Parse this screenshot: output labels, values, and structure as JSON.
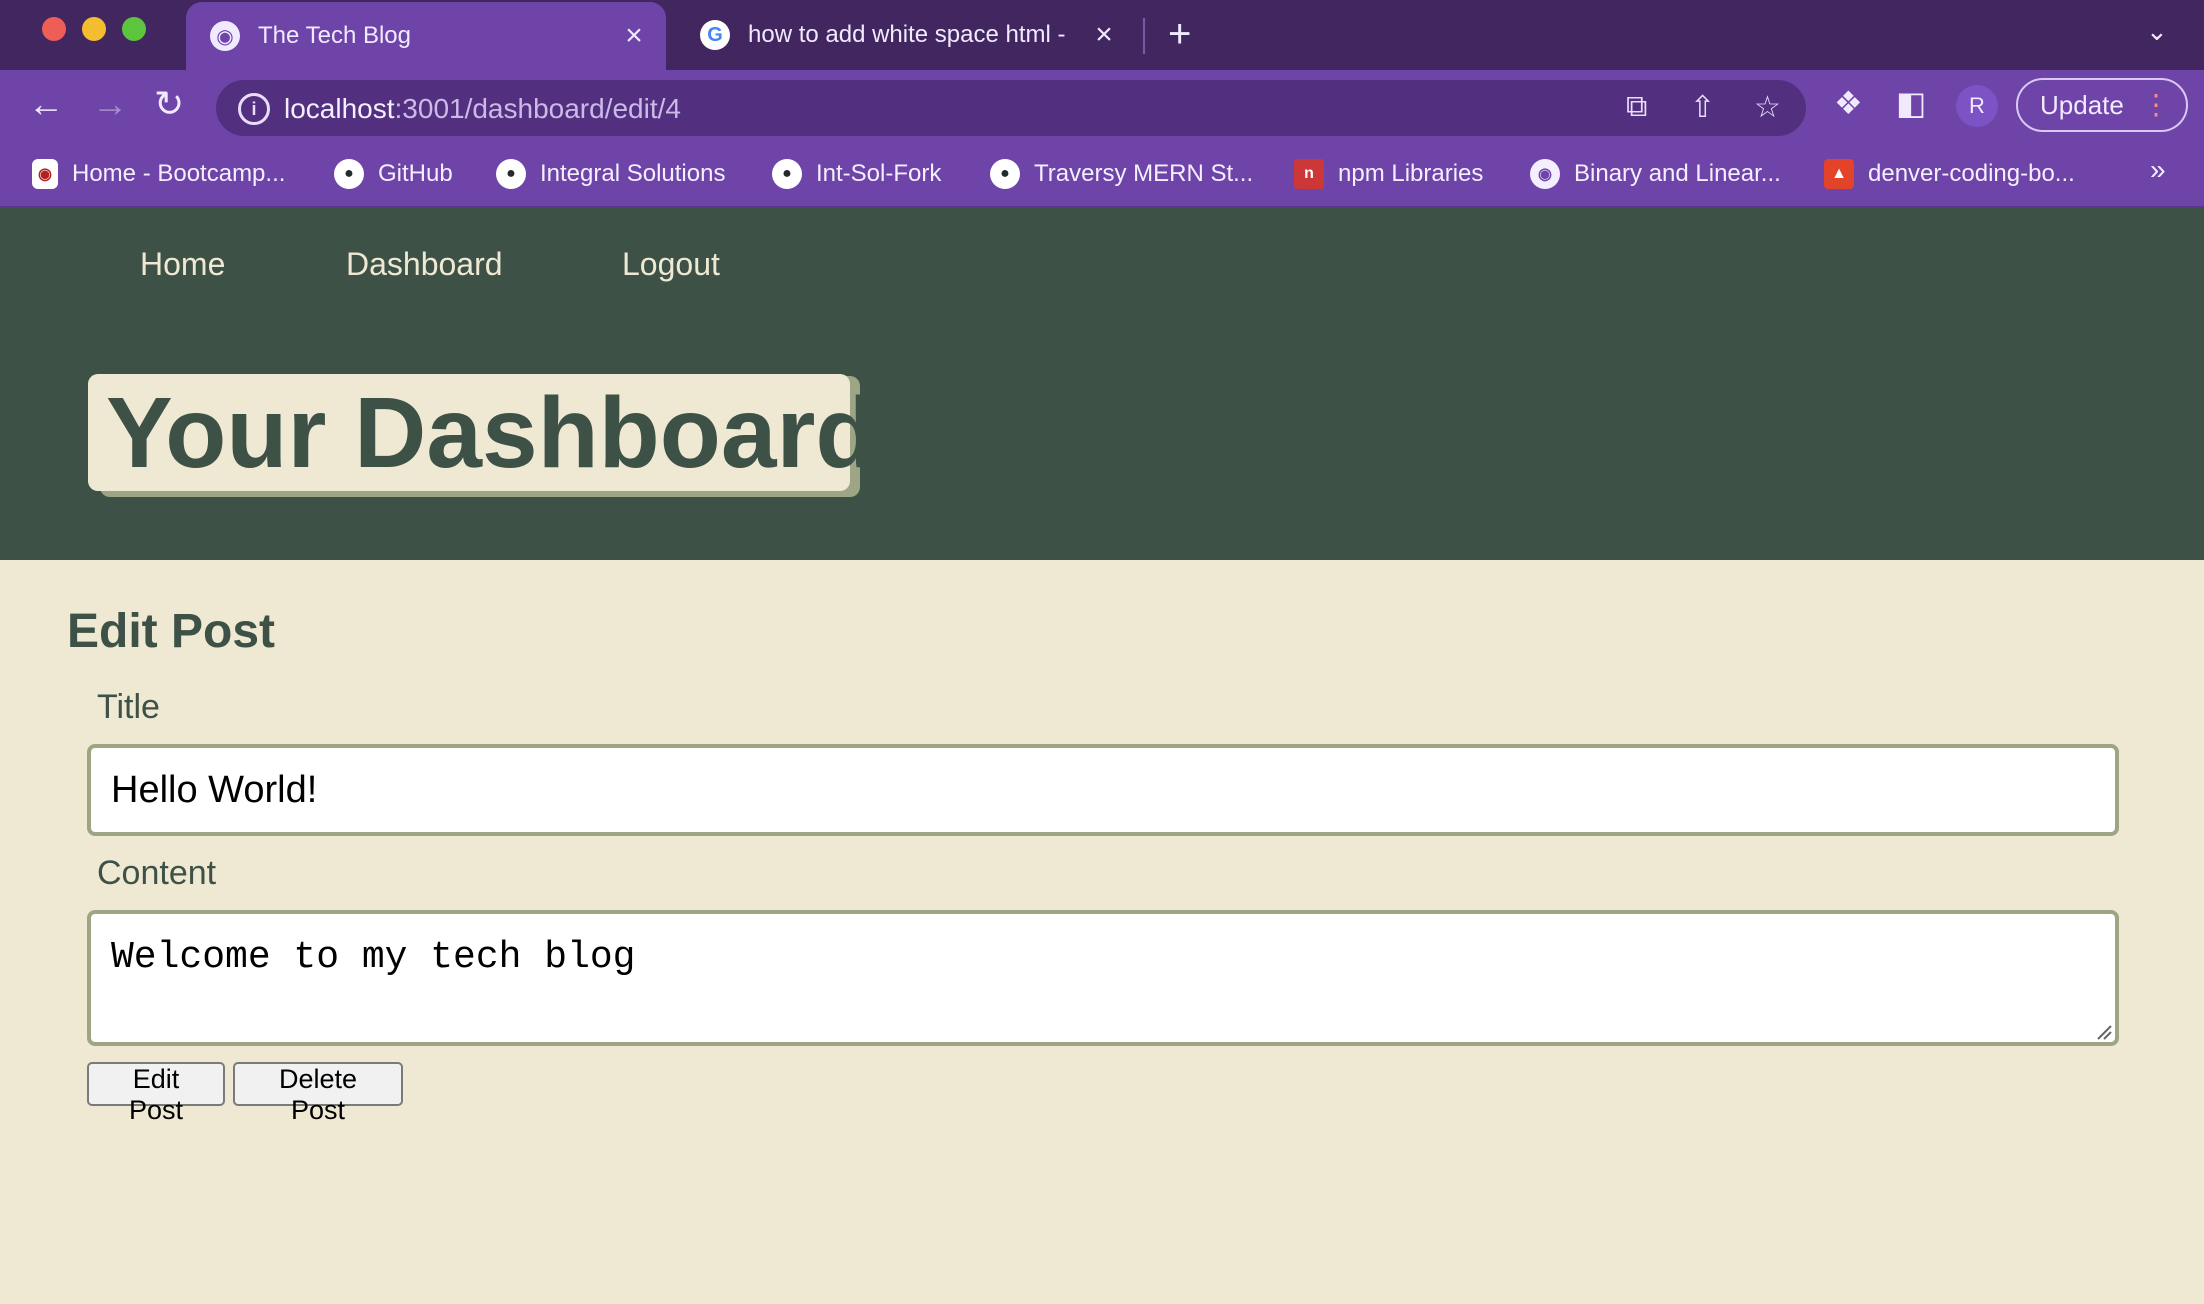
{
  "browser": {
    "tabs": [
      {
        "title": "The Tech Blog",
        "active": true
      },
      {
        "title": "how to add white space html -",
        "active": false
      }
    ],
    "address": {
      "host": "localhost",
      "path": ":3001/dashboard/edit/4"
    },
    "update_label": "Update",
    "avatar_initial": "R",
    "bookmarks": [
      {
        "label": "Home - Bootcamp...",
        "icon": "bootcamp-icon"
      },
      {
        "label": "GitHub",
        "icon": "github-icon"
      },
      {
        "label": "Integral Solutions",
        "icon": "github-icon"
      },
      {
        "label": "Int-Sol-Fork",
        "icon": "github-icon"
      },
      {
        "label": "Traversy MERN St...",
        "icon": "github-icon"
      },
      {
        "label": "npm Libraries",
        "icon": "npm-icon"
      },
      {
        "label": "Binary and Linear...",
        "icon": "globe-icon"
      },
      {
        "label": "denver-coding-bo...",
        "icon": "gitlab-icon"
      }
    ]
  },
  "site": {
    "nav": [
      "Home",
      "Dashboard",
      "Logout"
    ],
    "hero_title": "Your Dashboard"
  },
  "form": {
    "heading": "Edit Post",
    "title_label": "Title",
    "title_value": "Hello World!",
    "content_label": "Content",
    "content_value": "Welcome to my tech blog",
    "edit_button": "Edit Post",
    "delete_button": "Delete Post"
  },
  "colors": {
    "chrome_dark": "#42265f",
    "chrome": "#6e44a8",
    "header_bg": "#3e5147",
    "page_bg": "#efe9d3",
    "accent_shadow": "#9ea584"
  }
}
